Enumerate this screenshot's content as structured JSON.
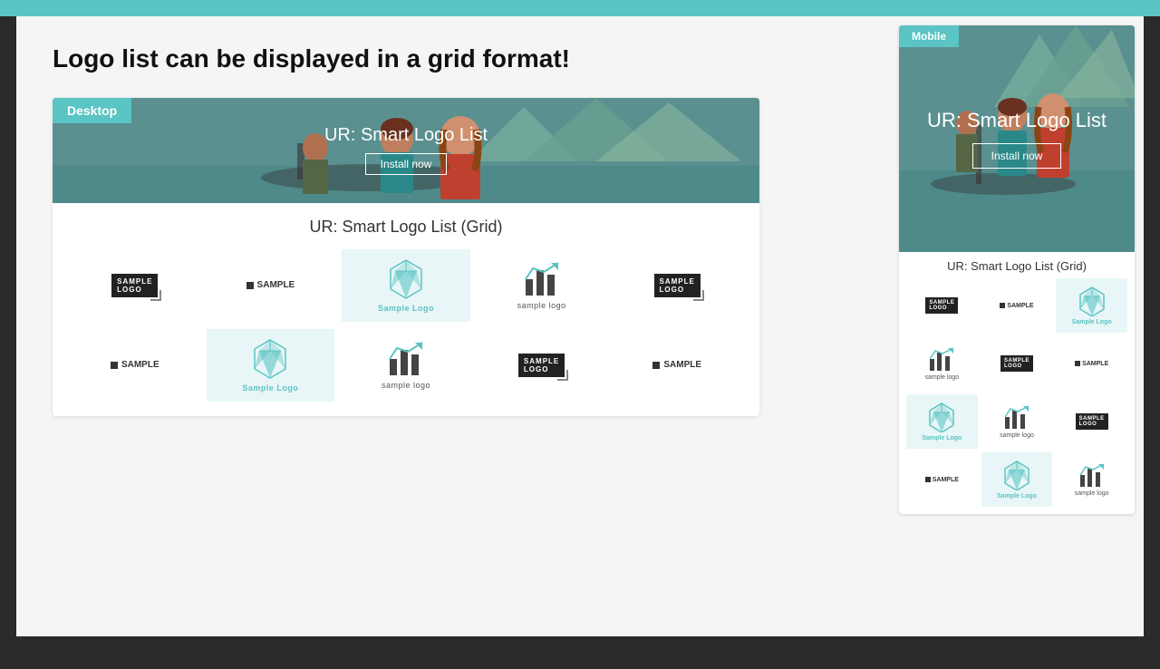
{
  "page": {
    "heading": "Logo list can be displayed in a grid format!",
    "background_color": "#2a2a2a"
  },
  "desktop": {
    "label": "Desktop",
    "banner_title": "UR: Smart Logo List",
    "install_button": "Install now",
    "grid_title": "UR: Smart Logo List (Grid)",
    "accent_color": "#5bc4c4"
  },
  "mobile": {
    "label": "Mobile",
    "banner_title": "UR: Smart Logo List",
    "install_button": "Install now",
    "grid_title": "UR: Smart Logo List (Grid)",
    "accent_color": "#5bc4c4"
  },
  "logos": {
    "sample_logo_caption": "Sample Logo",
    "sample_logo_caption_dark": "sample logo"
  }
}
